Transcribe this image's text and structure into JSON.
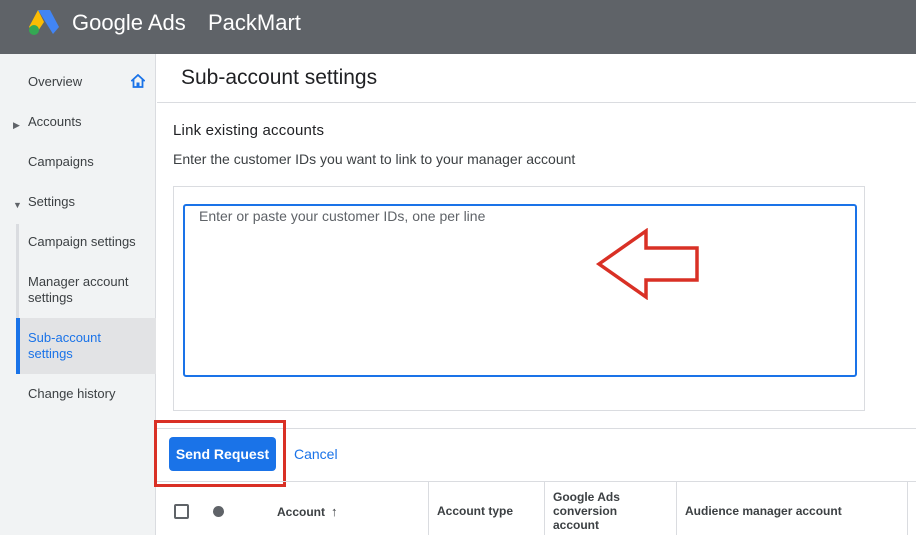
{
  "header": {
    "brand": "Google Ads",
    "account_name": "PackMart"
  },
  "sidebar": {
    "items": [
      {
        "label": "Overview",
        "icon": "home-icon"
      },
      {
        "label": "Accounts",
        "caret": "right"
      },
      {
        "label": "Campaigns"
      },
      {
        "label": "Settings",
        "caret": "down"
      },
      {
        "label": "Campaign settings"
      },
      {
        "label": "Manager account settings"
      },
      {
        "label": "Sub-account settings",
        "active": true
      },
      {
        "label": "Change history"
      }
    ]
  },
  "main": {
    "page_title": "Sub-account settings",
    "section_title": "Link existing accounts",
    "section_desc": "Enter the customer IDs you want to link to your manager account",
    "input_placeholder": "Enter or paste your customer IDs, one per line",
    "send_label": "Send Request",
    "cancel_label": "Cancel",
    "table_headers": {
      "account": "Account",
      "account_type": "Account type",
      "conversion_account": "Google Ads conversion account",
      "audience_manager": "Audience manager account"
    }
  },
  "colors": {
    "accent": "#1a73e8",
    "topbar": "#5f6368",
    "annotation": "#d93025"
  }
}
